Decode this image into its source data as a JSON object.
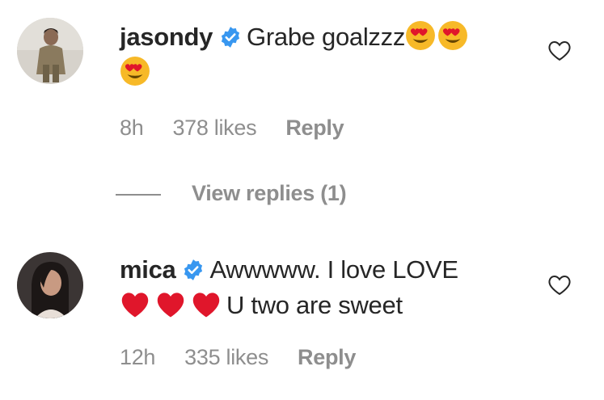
{
  "comments": [
    {
      "username": "jasondy",
      "verified": true,
      "text": "Grabe goalzzz",
      "emojis": [
        "smiling-face-with-heart-eyes",
        "smiling-face-with-heart-eyes",
        "smiling-face-with-heart-eyes"
      ],
      "time": "8h",
      "likes": "378 likes",
      "reply_label": "Reply",
      "view_replies": "View replies (1)"
    },
    {
      "username": "mica",
      "verified": true,
      "text_prefix": "Awwwww. I love LOVE",
      "emojis": [
        "red-heart",
        "red-heart",
        "red-heart"
      ],
      "text_suffix": "U two are sweet",
      "time": "12h",
      "likes": "335 likes",
      "reply_label": "Reply"
    }
  ],
  "colors": {
    "text": "#262626",
    "secondary": "#8e8e8e",
    "verified_blue": "#3897f0",
    "heart_red": "#e0162b",
    "emoji_yellow": "#f7b928"
  }
}
